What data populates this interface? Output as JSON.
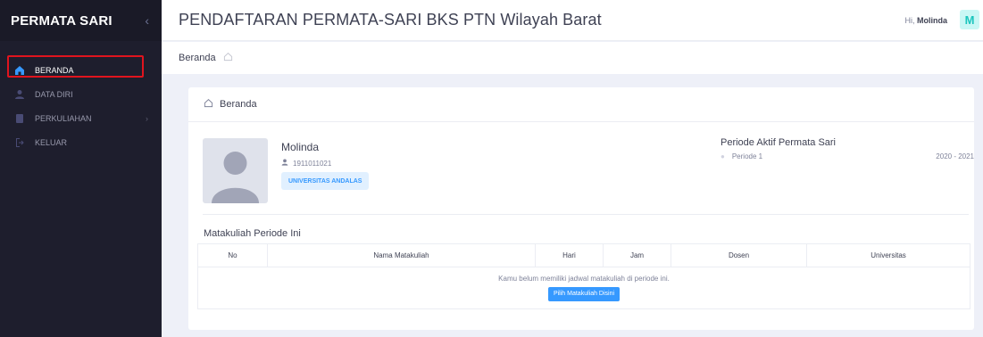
{
  "sidebar": {
    "brand": "PERMATA SARI",
    "items": [
      {
        "label": "BERANDA",
        "icon": "home-icon"
      },
      {
        "label": "DATA DIRI",
        "icon": "user-icon"
      },
      {
        "label": "PERKULIAHAN",
        "icon": "document-icon"
      },
      {
        "label": "KELUAR",
        "icon": "logout-icon"
      }
    ]
  },
  "header": {
    "title": "PENDAFTARAN PERMATA-SARI BKS PTN Wilayah Barat",
    "greeting": "Hi,",
    "user_name": "Molinda",
    "avatar_letter": "M"
  },
  "breadcrumb": {
    "label": "Beranda"
  },
  "card": {
    "title": "Beranda",
    "profile": {
      "name": "Molinda",
      "id": "1911011021",
      "university": "UNIVERSITAS ANDALAS"
    },
    "periode": {
      "title": "Periode Aktif Permata Sari",
      "name": "Periode 1",
      "year": "2020 - 2021"
    },
    "courses": {
      "title": "Matakuliah Periode Ini",
      "columns": [
        "No",
        "Nama Matakuliah",
        "Hari",
        "Jam",
        "Dosen",
        "Universitas"
      ],
      "empty_message": "Kamu belum memiliki jadwal matakuliah di periode ini.",
      "pick_button": "Pilih Matakuliah Disini"
    }
  },
  "colors": {
    "sidebar_bg": "#1e1e2d",
    "accent": "#3699ff",
    "highlight": "#e0141e",
    "avatar_bg": "#c9f7f5",
    "avatar_fg": "#1bc5bd"
  }
}
